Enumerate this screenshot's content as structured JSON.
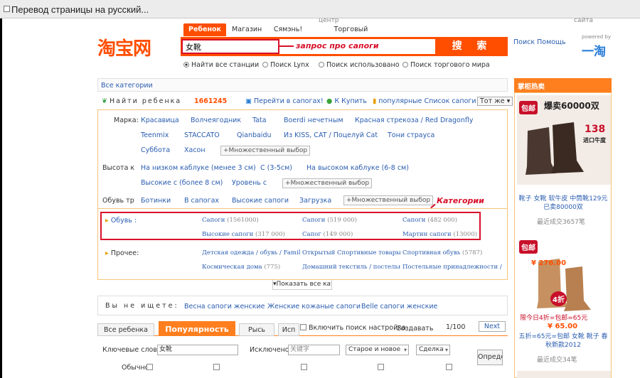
{
  "window": {
    "title": "Перевод страницы на русский..."
  },
  "logo": {
    "text": "淘宝网",
    "color": "#ff4e00"
  },
  "header": {
    "top_labels": [
      "центр",
      "сайта"
    ],
    "tabs": [
      "Ребенок",
      "Магазин",
      "Сямэнь!",
      "Торговый руководство"
    ],
    "search_value": "女靴",
    "search_button": "搜 索",
    "help_link": "Поиск Помощь",
    "powered_by": "powered by",
    "powered_logo": "一淘",
    "annotation_query": "запрос про сапоги"
  },
  "search_scope": {
    "options": [
      "Найти все станции",
      "Поиск Lynx",
      "Поиск использовано",
      "Поиск торгового мира"
    ],
    "selected": 0
  },
  "breadcrumb": "Все категории",
  "results_bar": {
    "label": "Найти ребенка",
    "count": "1661245",
    "links": [
      "Перейти в сапогах!",
      "К Купить",
      "популярные Список сапоги"
    ],
    "sort": "Тот же"
  },
  "filters": {
    "brand_label": "Марка:",
    "brands_row1": [
      "Красавица",
      "Волчеягодник",
      "Tata",
      "Boerdi нечетным",
      "Красная стрекоза / Red Dragonfly"
    ],
    "brands_row2": [
      "Teenmix",
      "STACCATO",
      "Qianbaidu",
      "Из KISS, CAT / Поцелуй Cat",
      "Тони страуса"
    ],
    "brands_row3": [
      "Суббота",
      "Хасон"
    ],
    "multi": "+Множественный выбор",
    "heel_label": "Высота каб",
    "heel_row1": [
      "На низком каблуке (менее 3 см)",
      "С (3-5см)",
      "На высоком каблуке (6-8 см)"
    ],
    "heel_row2": [
      "Высокие с (более 8 см)",
      "Уровень с"
    ],
    "shoe_label": "Обувь труб",
    "shoe_row": [
      "Ботинки",
      "В сапогах",
      "Высокие сапоги",
      "Загрузка"
    ]
  },
  "categories": {
    "annotation": "Категории",
    "shoes_label": "Обувь :",
    "shoes_items": [
      {
        "name": "Сапоги",
        "count": "(1561000)"
      },
      {
        "name": "Сапоги",
        "count": "(519 000)"
      },
      {
        "name": "Сапоги",
        "count": "(482 000)"
      },
      {
        "name": "Высокие сапоги",
        "count": "(317 000)"
      },
      {
        "name": "Сапог",
        "count": "(149 000)"
      },
      {
        "name": "Мартин сапоги",
        "count": "(13000)"
      }
    ],
    "other_label": "Прочее:",
    "other_items": [
      {
        "name": "Детская одежда / обувь / Family P",
        "count": ""
      },
      {
        "name": "Открытый Спортивные товары",
        "count": "("
      },
      {
        "name": "Спортивная обувь",
        "count": "(5787)"
      },
      {
        "name": "Космическая дома",
        "count": "(775)"
      },
      {
        "name": "Домашний текстиль / постельные",
        "count": ""
      },
      {
        "name": "Постельные принадлежности / По",
        "count": ""
      }
    ],
    "show_all": "Показать все кате"
  },
  "suggest": {
    "label": "Вы не ищете:",
    "items": [
      "Весна сапоги женские",
      "Женские кожаные сапоги",
      "Belle сапоги женские"
    ]
  },
  "bottom_tabs": {
    "items": [
      "Все ребенка",
      "Популярность",
      "Рысь",
      "Исп"
    ],
    "active": 1,
    "checkbox_label": "Включить поиск настройка",
    "create": "Создавать",
    "page": "1/100",
    "next": "Next"
  },
  "form": {
    "keywords_label": "Ключевые слова:",
    "keywords_value": "女靴",
    "excluded_label": "Исключено:",
    "excluded_placeholder": "关键字",
    "sort1": "Старое и новое",
    "sort2": "Сделка",
    "submit": "Опреде",
    "normal_label": "Обычно"
  },
  "sidebar": {
    "title": "掌柜热卖",
    "items": [
      {
        "badge": "包邮",
        "promo": "爆卖60000双",
        "sale": "138",
        "sale_note": "进口牛度",
        "title": "靴子 女靴 软牛皮 中筒靴129元 已卖80000双",
        "sold": "最近成交3657笔"
      },
      {
        "badge": "包邮",
        "price": "¥ 276.00",
        "discount": "4折",
        "promo": "限今日4折=包邮=65元",
        "price2": "¥ 65.00",
        "title": "五折=65元=包邮 女靴 靴子 春秋新款2012",
        "sold": "最近成交34笔"
      }
    ]
  }
}
